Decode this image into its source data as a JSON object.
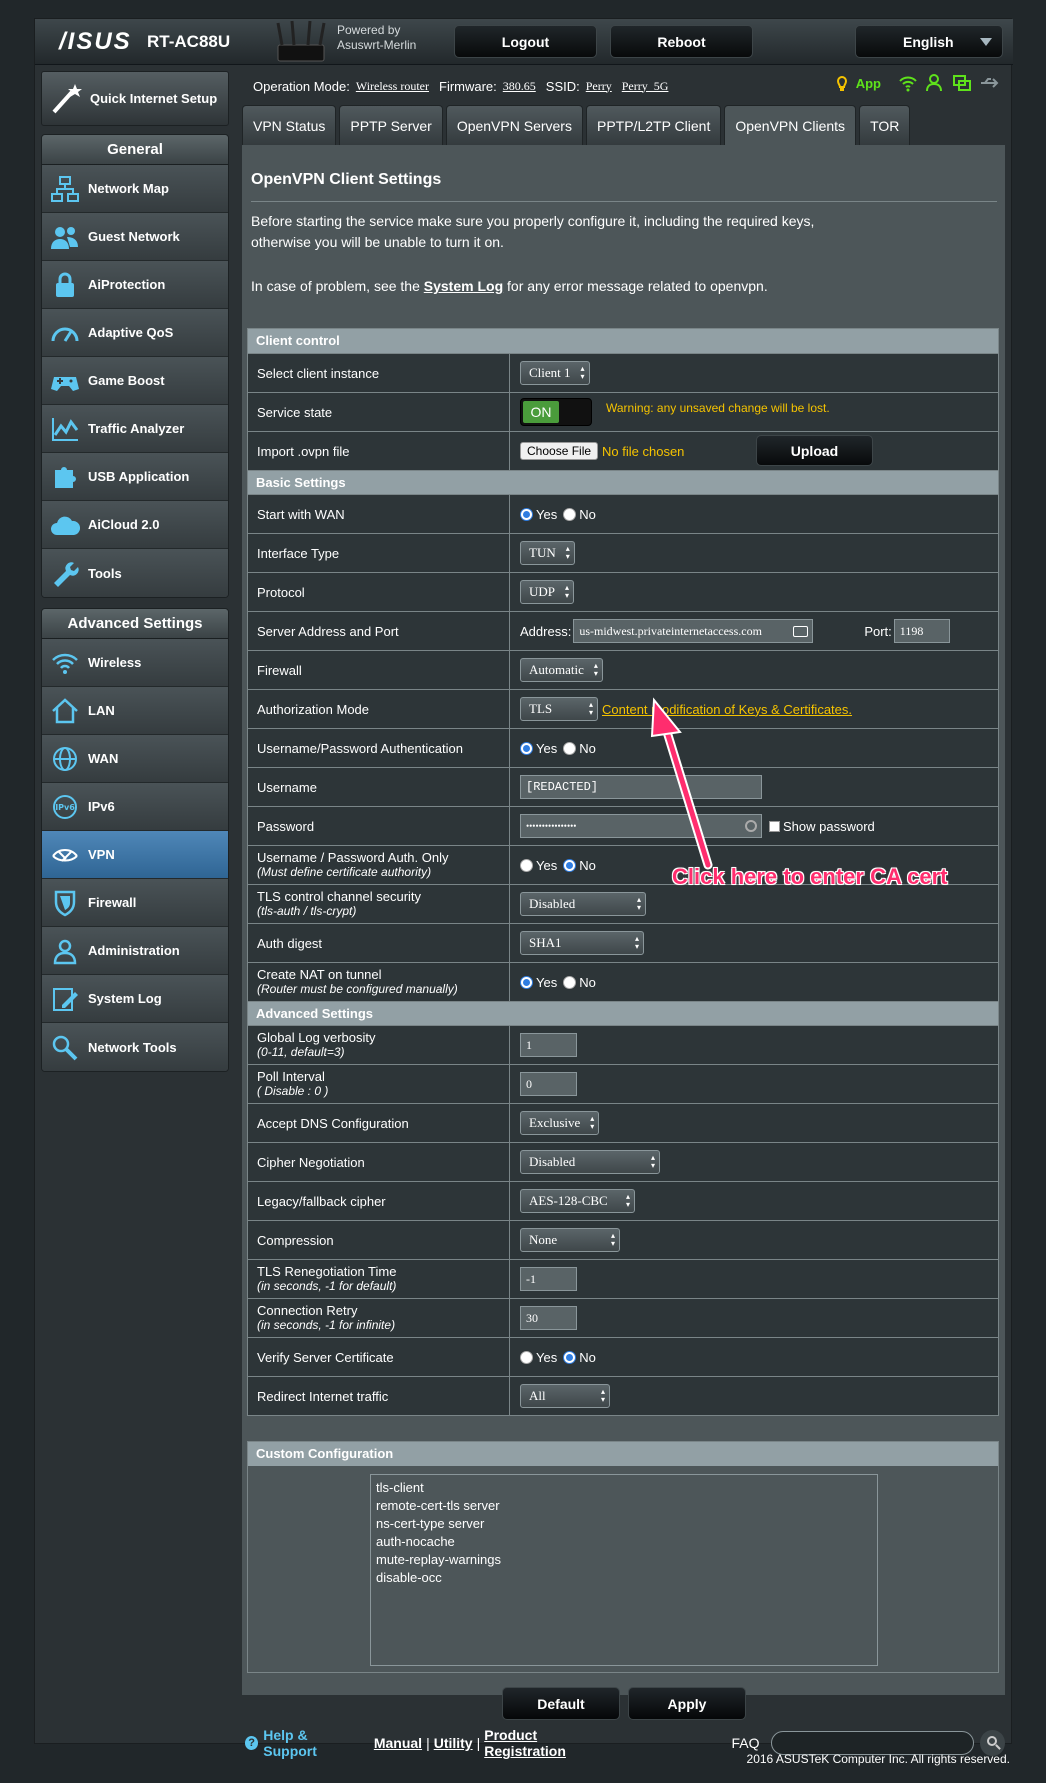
{
  "header": {
    "brand": "/ISUS",
    "model": "RT-AC88U",
    "powered_by": "Powered by",
    "firmware_name": "Asuswrt-Merlin",
    "logout": "Logout",
    "reboot": "Reboot",
    "language": "English"
  },
  "sidebar": {
    "quick_setup": "Quick Internet Setup",
    "general_title": "General",
    "general_items": [
      "Network Map",
      "Guest Network",
      "AiProtection",
      "Adaptive QoS",
      "Game Boost",
      "Traffic Analyzer",
      "USB Application",
      "AiCloud 2.0",
      "Tools"
    ],
    "advanced_title": "Advanced Settings",
    "advanced_items": [
      "Wireless",
      "LAN",
      "WAN",
      "IPv6",
      "VPN",
      "Firewall",
      "Administration",
      "System Log",
      "Network Tools"
    ]
  },
  "opbar": {
    "mode_label": "Operation Mode:",
    "mode_value": "Wireless router",
    "fw_label": "Firmware:",
    "fw_value": "380.65",
    "ssid_label": "SSID:",
    "ssid1": "Perry",
    "ssid2": "Perry_5G",
    "app": "App"
  },
  "tabs": [
    "VPN Status",
    "PPTP Server",
    "OpenVPN Servers",
    "PPTP/L2TP Client",
    "OpenVPN Clients",
    "TOR"
  ],
  "page": {
    "title": "OpenVPN Client Settings",
    "intro1": "Before starting the service make sure you properly configure it, including the required keys,",
    "intro2": "otherwise you will be unable to turn it on.",
    "problem_pre": "In case of problem, see the",
    "problem_link": "System Log",
    "problem_post": "for any error message related to openvpn."
  },
  "client_control": {
    "title": "Client control",
    "select_label": "Select client instance",
    "select_value": "Client 1",
    "state_label": "Service state",
    "state_value": "ON",
    "warning": "Warning: any unsaved change will be lost.",
    "import_label": "Import .ovpn file",
    "choose_file": "Choose File",
    "no_file": "No file chosen",
    "upload": "Upload"
  },
  "basic": {
    "title": "Basic Settings",
    "start_wan": "Start with WAN",
    "yes": "Yes",
    "no": "No",
    "iface_label": "Interface Type",
    "iface_value": "TUN",
    "proto_label": "Protocol",
    "proto_value": "UDP",
    "server_label": "Server Address and Port",
    "address_label": "Address:",
    "address_value": "us-midwest.privateinternetaccess.com",
    "port_label": "Port:",
    "port_value": "1198",
    "firewall_label": "Firewall",
    "firewall_value": "Automatic",
    "auth_label": "Authorization Mode",
    "auth_value": "TLS",
    "auth_link": "Content modification of Keys & Certificates.",
    "userpass_label": "Username/Password Authentication",
    "username_label": "Username",
    "username_value": "[REDACTED]",
    "password_label": "Password",
    "password_value": "••••••••••••••••",
    "show_password": "Show password",
    "userpass_only_label": "Username / Password Auth. Only",
    "userpass_only_note": "(Must define certificate authority)",
    "tls_label": "TLS control channel security",
    "tls_note": "(tls-auth / tls-crypt)",
    "tls_value": "Disabled",
    "digest_label": "Auth digest",
    "digest_value": "SHA1",
    "nat_label": "Create NAT on tunnel",
    "nat_note": "(Router must be configured manually)"
  },
  "advanced": {
    "title": "Advanced Settings",
    "verb_label": "Global Log verbosity",
    "verb_note": "(0-11, default=3)",
    "verb_value": "1",
    "poll_label": "Poll Interval",
    "poll_note": "( Disable : 0 )",
    "poll_value": "0",
    "dns_label": "Accept DNS Configuration",
    "dns_value": "Exclusive",
    "cipher_neg_label": "Cipher Negotiation",
    "cipher_neg_value": "Disabled",
    "legacy_label": "Legacy/fallback cipher",
    "legacy_value": "AES-128-CBC",
    "comp_label": "Compression",
    "comp_value": "None",
    "reneg_label": "TLS Renegotiation Time",
    "reneg_note": "(in seconds, -1 for default)",
    "reneg_value": "-1",
    "retry_label": "Connection Retry",
    "retry_note": "(in seconds, -1 for infinite)",
    "retry_value": "30",
    "verify_label": "Verify Server Certificate",
    "redirect_label": "Redirect Internet traffic",
    "redirect_value": "All"
  },
  "custom": {
    "title": "Custom Configuration",
    "text": "tls-client\nremote-cert-tls server\nns-cert-type server\nauth-nocache\nmute-replay-warnings\ndisable-occ"
  },
  "buttons": {
    "default": "Default",
    "apply": "Apply"
  },
  "footer": {
    "help": "Help & Support",
    "manual": "Manual",
    "utility": "Utility",
    "registration": "Product Registration",
    "faq": "FAQ",
    "copyright": "2016 ASUSTeK Computer Inc. All rights reserved."
  },
  "annotation": "Click here to enter CA cert",
  "colors": {
    "accent_yellow": "#f5c300",
    "callout": "#ff2d6e",
    "active_nav": "#3a75a8",
    "toggle_on": "#4a9c3b"
  }
}
